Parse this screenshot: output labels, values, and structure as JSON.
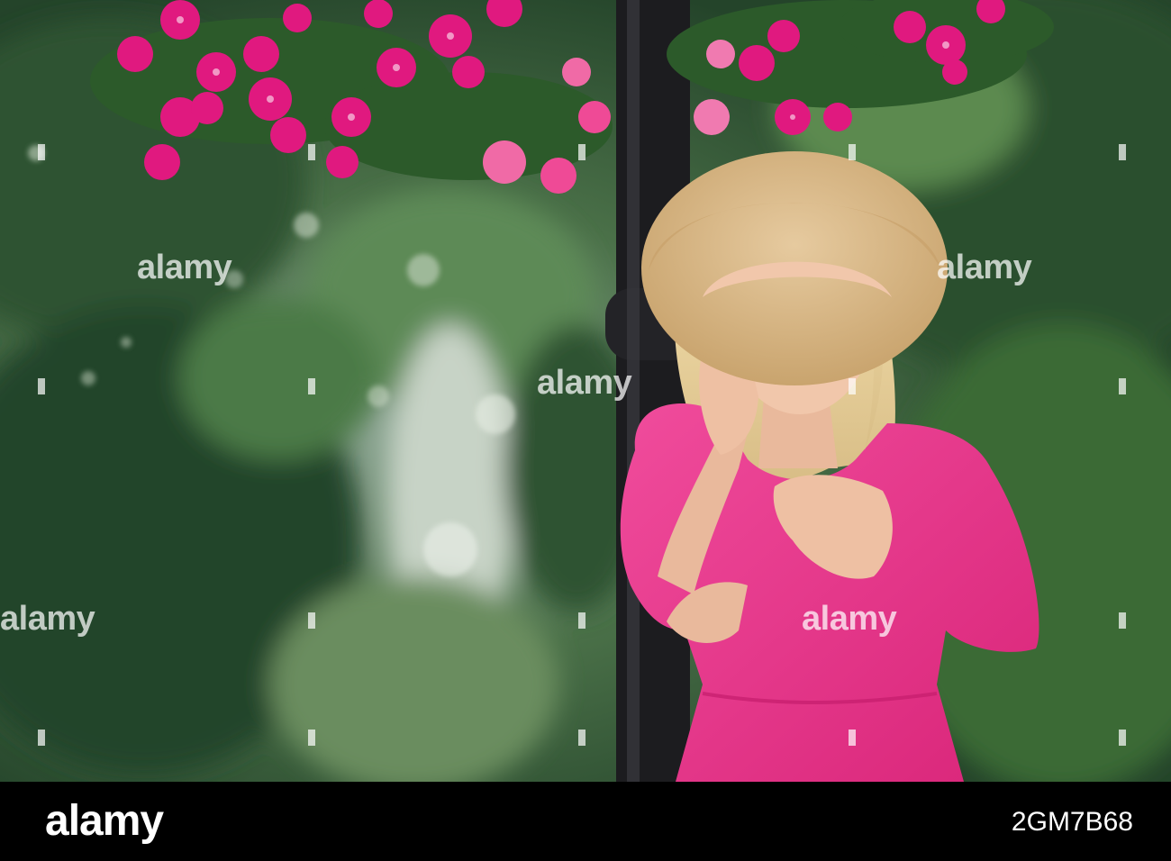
{
  "watermark": {
    "text": "alamy"
  },
  "footer": {
    "brand": "alamy",
    "image_id": "2GM7B68"
  },
  "colors": {
    "dress": "#ec3a8f",
    "hat": "#d9b98c",
    "foliage": "#3f6b3a",
    "flowers": "#e0197f"
  }
}
